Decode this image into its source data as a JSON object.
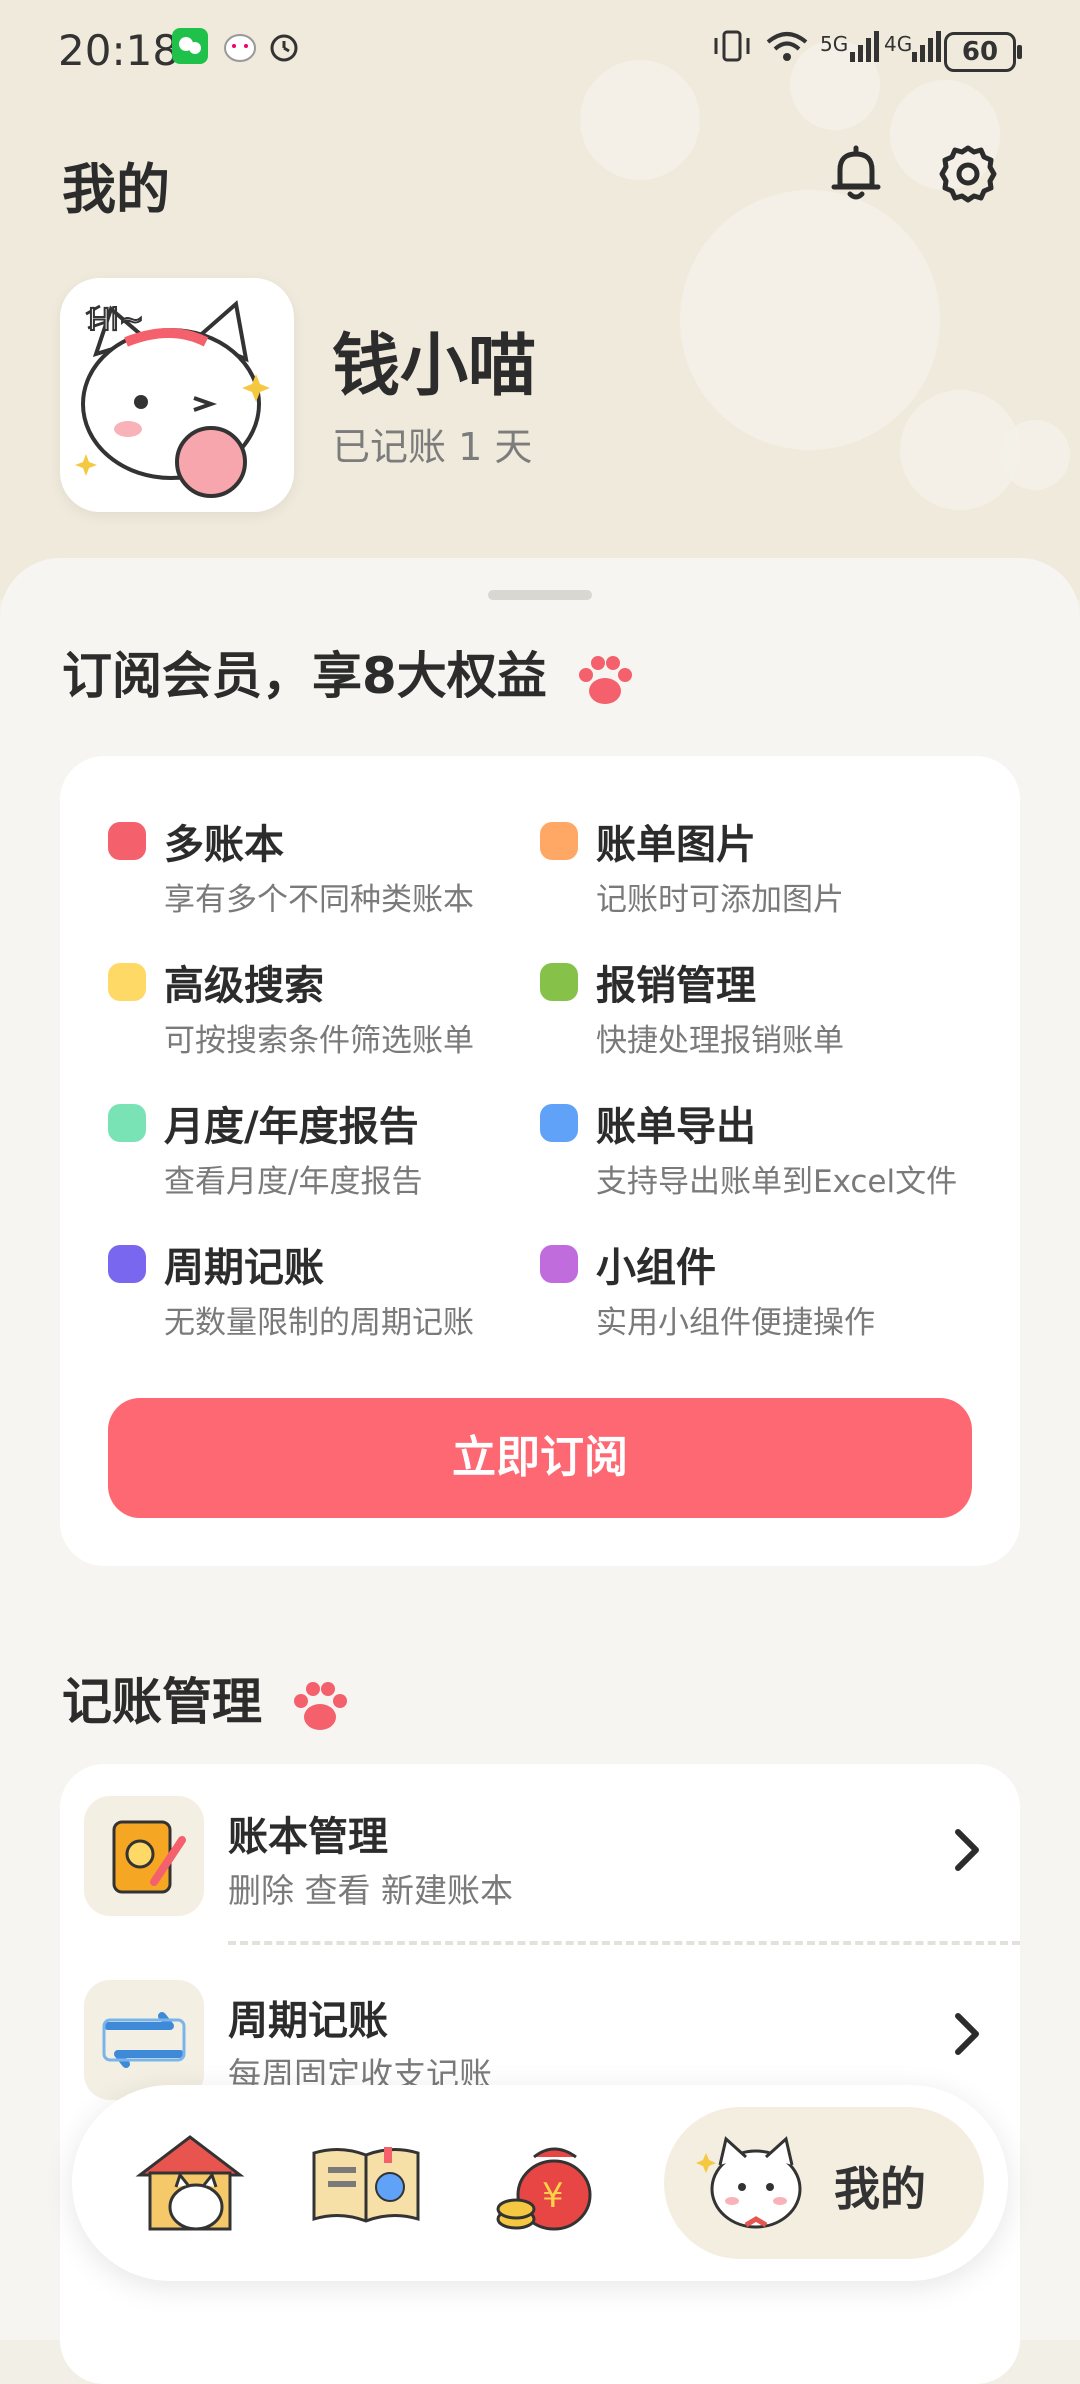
{
  "status_bar": {
    "time": "20:18",
    "network_1": "5G",
    "network_2": "4G",
    "battery": "60"
  },
  "header": {
    "title": "我的"
  },
  "profile": {
    "name": "钱小喵",
    "days": "已记账 1 天"
  },
  "subscription": {
    "title": "订阅会员，享8大权益",
    "benefits": [
      {
        "title": "多账本",
        "desc": "享有多个不同种类账本",
        "color": "#f4606c"
      },
      {
        "title": "账单图片",
        "desc": "记账时可添加图片",
        "color": "#ffa866"
      },
      {
        "title": "高级搜索",
        "desc": "可按搜索条件筛选账单",
        "color": "#ffd966"
      },
      {
        "title": "报销管理",
        "desc": "快捷处理报销账单",
        "color": "#86c24a"
      },
      {
        "title": "月度/年度报告",
        "desc": "查看月度/年度报告",
        "color": "#79e3b5"
      },
      {
        "title": "账单导出",
        "desc": "支持导出账单到Excel文件",
        "color": "#5fa2f7"
      },
      {
        "title": "周期记账",
        "desc": "无数量限制的周期记账",
        "color": "#7a67f0"
      },
      {
        "title": "小组件",
        "desc": "实用小组件便捷操作",
        "color": "#c06cdd"
      }
    ],
    "button": "立即订阅"
  },
  "management": {
    "title": "记账管理",
    "items": [
      {
        "title": "账本管理",
        "desc": "删除 查看 新建账本",
        "icon": "ledger-icon"
      },
      {
        "title": "周期记账",
        "desc": "每周固定收支记账",
        "icon": "cycle-icon"
      }
    ]
  },
  "bottom_nav": {
    "items": [
      {
        "icon": "home-icon"
      },
      {
        "icon": "book-icon"
      },
      {
        "icon": "money-bag-icon"
      }
    ],
    "active_label": "我的"
  }
}
